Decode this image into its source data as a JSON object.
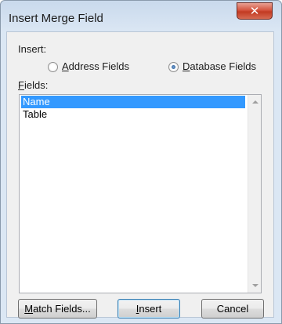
{
  "dialog": {
    "title": "Insert Merge Field",
    "close_glyph": "✕",
    "insert_label": "Insert:",
    "radio_address": {
      "mnemonic": "A",
      "rest": "ddress Fields",
      "checked": false
    },
    "radio_database": {
      "mnemonic": "D",
      "rest": "atabase Fields",
      "checked": true
    },
    "fields_label": {
      "mnemonic": "F",
      "rest": "ields:"
    },
    "fields": [
      {
        "label": "Name",
        "selected": true
      },
      {
        "label": "Table",
        "selected": false
      }
    ],
    "buttons": {
      "match": {
        "mnemonic": "M",
        "rest": "atch Fields..."
      },
      "insert": {
        "mnemonic": "I",
        "rest": "nsert"
      },
      "cancel": "Cancel"
    }
  },
  "icons": {
    "close": "close-icon",
    "scroll_up": "chevron-up-icon",
    "scroll_down": "chevron-down-icon"
  }
}
